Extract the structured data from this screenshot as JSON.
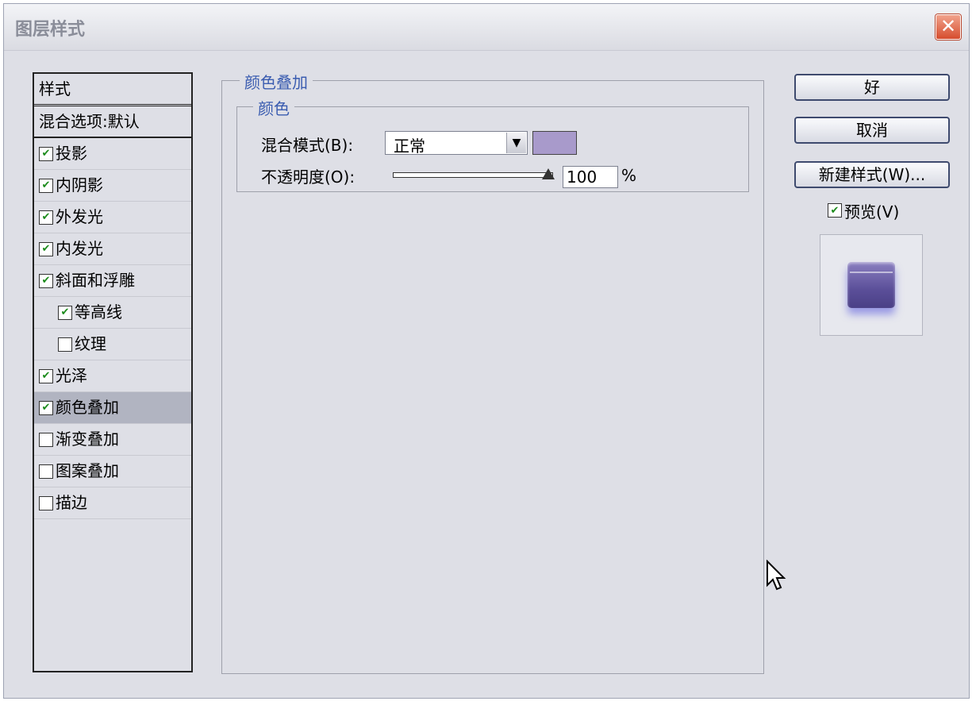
{
  "dialog": {
    "title": "图层样式",
    "close_symbol": "✕"
  },
  "styles_panel": {
    "header": "样式",
    "blending_options": "混合选项:默认",
    "items": [
      {
        "label": "投影",
        "checked": true
      },
      {
        "label": "内阴影",
        "checked": true
      },
      {
        "label": "外发光",
        "checked": true
      },
      {
        "label": "内发光",
        "checked": true
      },
      {
        "label": "斜面和浮雕",
        "checked": true
      },
      {
        "label": "等高线",
        "checked": true
      },
      {
        "label": "纹理",
        "checked": false
      },
      {
        "label": "光泽",
        "checked": true
      },
      {
        "label": "颜色叠加",
        "checked": true,
        "selected": true
      },
      {
        "label": "渐变叠加",
        "checked": false
      },
      {
        "label": "图案叠加",
        "checked": false
      },
      {
        "label": "描边",
        "checked": false
      }
    ]
  },
  "color_overlay": {
    "group_title": "颜色叠加",
    "subgroup_title": "颜色",
    "blend_mode_label": "混合模式(B):",
    "blend_mode_value": "正常",
    "color": "#a89acb",
    "opacity_label": "不透明度(O):",
    "opacity_value": "100",
    "opacity_unit": "%",
    "opacity_fraction": 1.0
  },
  "buttons": {
    "ok": "好",
    "cancel": "取消",
    "new_style": "新建样式(W)..."
  },
  "preview": {
    "label": "预览(V)",
    "checked": true
  },
  "check_mark": "✔"
}
